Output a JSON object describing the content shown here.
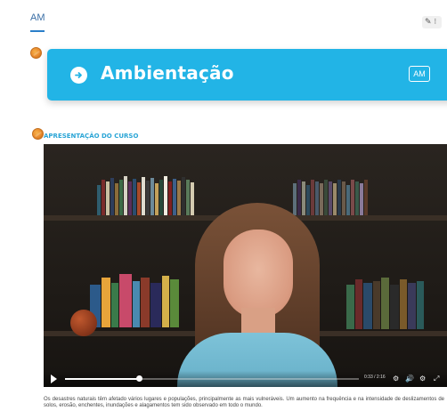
{
  "tabs": {
    "active_label": "AM"
  },
  "edit_button": {
    "icon": "pencil-icon",
    "label": "✎ ⁝"
  },
  "banner": {
    "title": "Ambientação",
    "badge": "AM",
    "color": "#22b4e6",
    "icon": "arrow-right-circle-icon"
  },
  "section": {
    "title": "APRESENTAÇÃO DO CURSO",
    "icon": "activity-icon"
  },
  "video": {
    "time": "0:33 / 2:16",
    "progress_fraction": 0.25,
    "controls": [
      "play-icon",
      "settings-icon",
      "volume-icon",
      "cc-icon",
      "fullscreen-icon"
    ]
  },
  "description": "Os desastres naturais têm afetado vários lugares e populações, principalmente as mais vulneráveis. Um aumento na frequência e na intensidade de deslizamentos de solos, erosão, enchentes, inundações e alagamentos tem sido observado em todo o mundo."
}
